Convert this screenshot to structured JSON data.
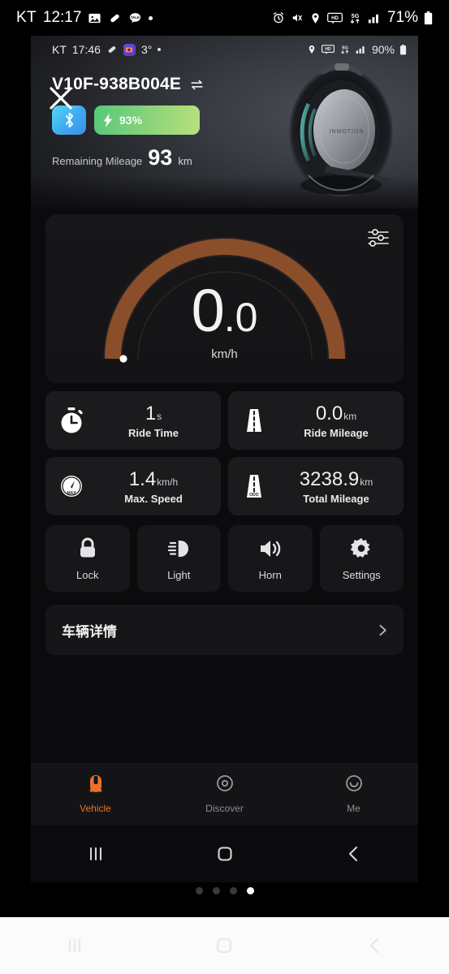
{
  "outer_status": {
    "carrier": "KT",
    "time": "12:17",
    "icons_left": [
      "image-icon",
      "pill-icon",
      "kakaotalk-icon",
      "dot-icon"
    ],
    "icons_right": [
      "alarm-icon",
      "mute-icon",
      "location-icon",
      "hd-icon",
      "5g-icon",
      "signal-icon"
    ],
    "battery_percent": "71%"
  },
  "inner_status": {
    "carrier": "KT",
    "time": "17:46",
    "temperature": "3°",
    "icons_left": [
      "pill-icon",
      "app-badge-icon",
      "dot-icon"
    ],
    "icons_right": [
      "location-icon",
      "hd-icon",
      "5g-icon",
      "signal-icon"
    ],
    "battery_percent": "90%"
  },
  "header": {
    "close_icon": "close-icon",
    "device_name": "V10F-938B004E",
    "switch_icon": "swap-device-icon",
    "bluetooth_icon": "bluetooth-icon",
    "battery_icon": "lightning-bolt-icon",
    "battery_percent": "93%",
    "remaining_mileage_label": "Remaining Mileage",
    "remaining_mileage_value": "93",
    "remaining_mileage_unit": "km",
    "product_image": "electric-unicycle-image"
  },
  "gauge": {
    "settings_icon": "sliders-icon",
    "speed_integer": "0",
    "speed_decimal": ".0",
    "unit": "km/h",
    "arc_color": "#8a4f2a",
    "arc_percent": 100
  },
  "stats": [
    {
      "icon": "stopwatch-icon",
      "value": "1",
      "unit": "s",
      "label": "Ride Time"
    },
    {
      "icon": "road-icon",
      "value": "0.0",
      "unit": "km",
      "label": "Ride Mileage"
    },
    {
      "icon": "max-speed-gauge-icon",
      "value": "1.4",
      "unit": "km/h",
      "label": "Max. Speed"
    },
    {
      "icon": "odometer-road-icon",
      "value": "3238.9",
      "unit": "km",
      "label": "Total Mileage"
    }
  ],
  "actions": [
    {
      "icon": "lock-icon",
      "label": "Lock"
    },
    {
      "icon": "headlight-icon",
      "label": "Light"
    },
    {
      "icon": "horn-speaker-icon",
      "label": "Horn"
    },
    {
      "icon": "gear-icon",
      "label": "Settings"
    }
  ],
  "details": {
    "label": "车辆详情",
    "chevron_icon": "chevron-right-icon"
  },
  "bottom_nav": {
    "active_color": "#e8722a",
    "items": [
      {
        "icon": "vehicle-icon",
        "label": "Vehicle",
        "active": true
      },
      {
        "icon": "discover-icon",
        "label": "Discover",
        "active": false
      },
      {
        "icon": "me-smiley-icon",
        "label": "Me",
        "active": false
      }
    ]
  },
  "inner_android_nav": [
    "recents-icon",
    "home-icon",
    "back-icon"
  ],
  "outer_android_nav": [
    "recents-icon",
    "home-icon",
    "back-icon"
  ],
  "page_dots": {
    "count": 4,
    "active_index": 3
  }
}
